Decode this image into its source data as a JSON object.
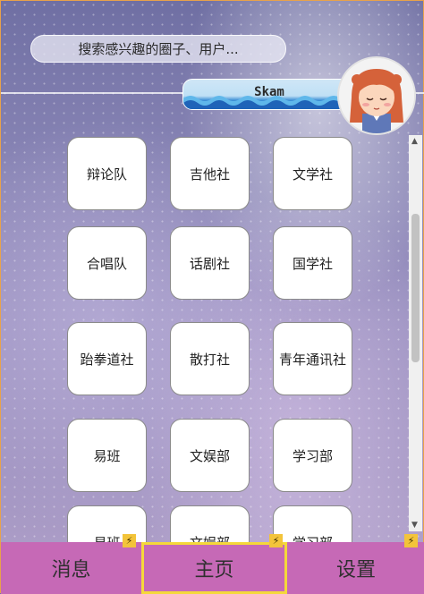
{
  "search": {
    "placeholder": "搜索感兴趣的圈子、用户..."
  },
  "banner": {
    "text": "Skam"
  },
  "clubs": [
    "辩论队",
    "吉他社",
    "文学社",
    "合唱队",
    "话剧社",
    "国学社",
    "跆拳道社",
    "散打社",
    "青年通讯社",
    "易班",
    "文娱部",
    "学习部",
    "易班",
    "文娱部",
    "学习部"
  ],
  "nav": {
    "messages": "消息",
    "home": "主页",
    "settings": "设置"
  },
  "icons": {
    "bolt": "⚡",
    "scroll_up": "▲",
    "scroll_down": "▼"
  },
  "colors": {
    "nav_bg": "#c669b6",
    "nav_active_border": "#f5d83a",
    "bolt": "#f3c43a"
  }
}
